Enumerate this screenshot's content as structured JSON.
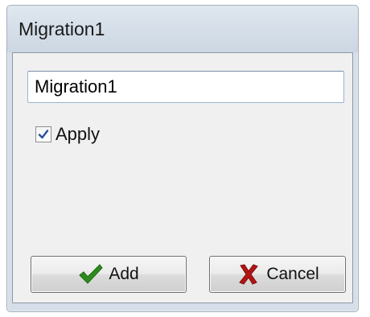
{
  "window": {
    "title": "Migration1"
  },
  "form": {
    "name_value": "Migration1",
    "apply_checked": true,
    "apply_label": "Apply"
  },
  "buttons": {
    "add_label": "Add",
    "add_icon": "checkmark-icon",
    "cancel_label": "Cancel",
    "cancel_icon": "x-icon"
  },
  "colors": {
    "check_green": "#2e8b1e",
    "cancel_red": "#b51414",
    "checkbox_tick": "#2a4f9c"
  }
}
